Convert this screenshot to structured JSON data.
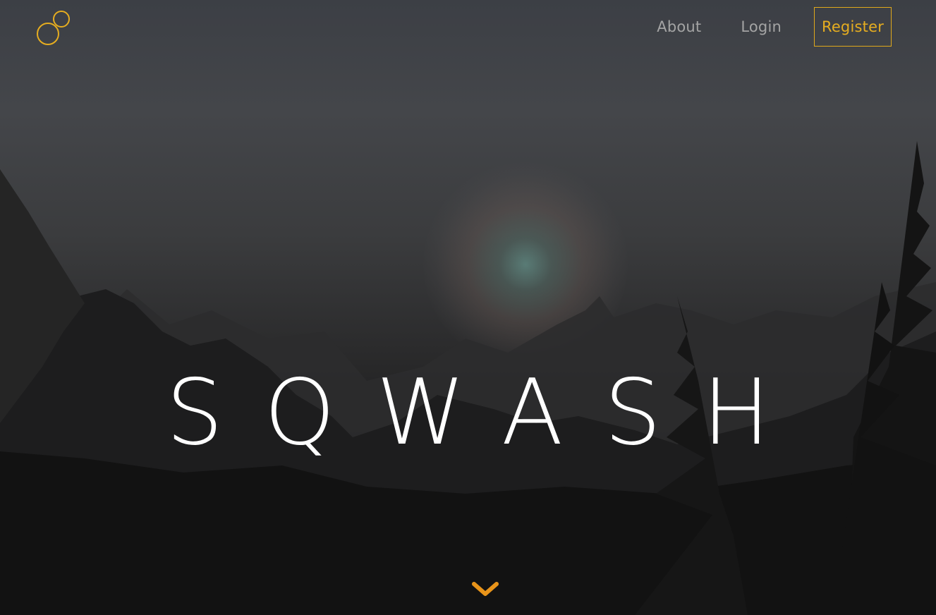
{
  "brand": {
    "logo_icon": "interlinked-rings-icon",
    "accent_color": "#e6ad20"
  },
  "nav": {
    "about_label": "About",
    "login_label": "Login",
    "register_label": "Register"
  },
  "hero": {
    "title": "SQWASH",
    "scroll_icon": "chevron-down-icon",
    "scroll_icon_color": "#e8941a"
  }
}
